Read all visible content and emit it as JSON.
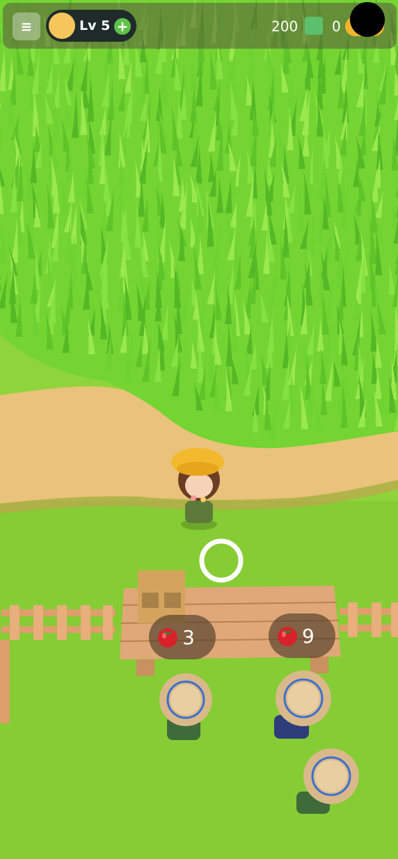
{
  "hud": {
    "menu_icon": "hamburger-menu-icon",
    "menu_glyph": "≡",
    "level_label": "Lv 5",
    "level_plus": "+",
    "cash": "200",
    "coins": "0",
    "colors": {
      "cash_icon": "#5cbf6e",
      "coin_icon": "#f2b32f",
      "level_pill": "#1f2a2a",
      "plus_button": "#5ec24a"
    }
  },
  "stands": [
    {
      "item": "tomato-icon",
      "count": "3"
    },
    {
      "item": "tomato-icon",
      "count": "9"
    }
  ],
  "scene": {
    "grass_color": "#8fd43a",
    "path_color": "#e9c27b",
    "crop_color": "#79d83a",
    "fence_color": "#de9f6c",
    "table_color": "#e0a878"
  }
}
